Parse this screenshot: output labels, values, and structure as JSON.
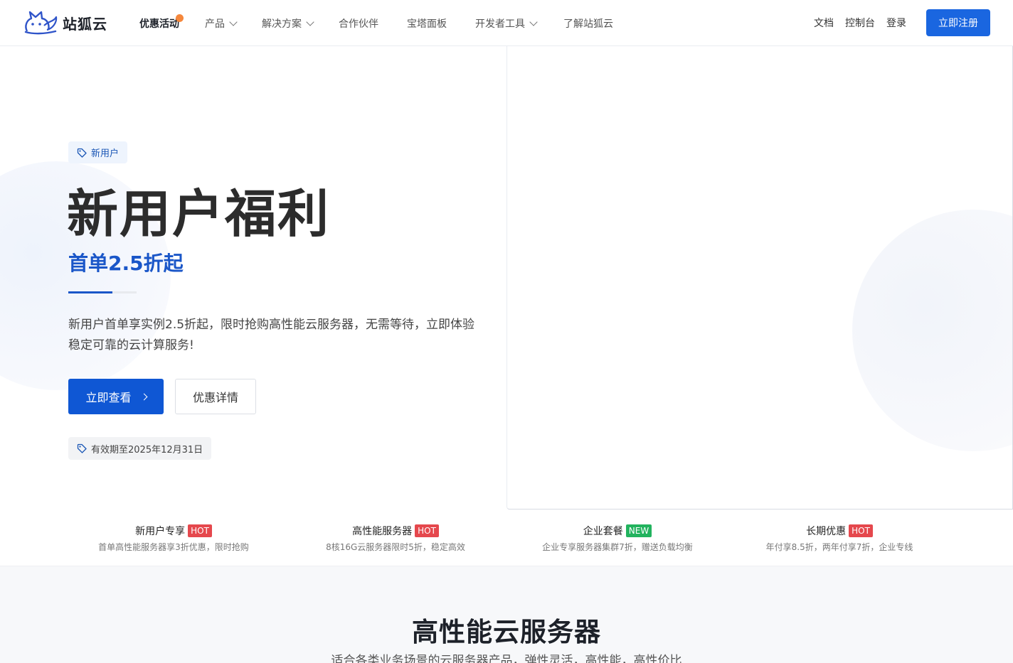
{
  "header": {
    "logo_text": "站狐云",
    "nav": [
      {
        "label": "优惠活动",
        "active": true,
        "dropdown": false
      },
      {
        "label": "产品",
        "active": false,
        "dropdown": true
      },
      {
        "label": "解决方案",
        "active": false,
        "dropdown": true
      },
      {
        "label": "合作伙伴",
        "active": false,
        "dropdown": false
      },
      {
        "label": "宝塔面板",
        "active": false,
        "dropdown": false
      },
      {
        "label": "开发者工具",
        "active": false,
        "dropdown": true
      },
      {
        "label": "了解站狐云",
        "active": false,
        "dropdown": false
      }
    ],
    "right_links": [
      "文档",
      "控制台",
      "登录"
    ],
    "register_label": "立即注册"
  },
  "hero": {
    "tag": "新用户",
    "title": "新用户福利",
    "subtitle": "首单2.5折起",
    "description": "新用户首单享实例2.5折起，限时抢购高性能云服务器，无需等待，立即体验稳定可靠的云计算服务!",
    "primary_button": "立即查看",
    "secondary_button": "优惠详情",
    "validity": "有效期至2025年12月31日"
  },
  "promos": [
    {
      "title": "新用户专享",
      "badge": "HOT",
      "badge_color": "#e5484d",
      "desc": "首单高性能服务器享3折优惠，限时抢购"
    },
    {
      "title": "高性能服务器",
      "badge": "HOT",
      "badge_color": "#e5484d",
      "desc": "8核16G云服务器限时5折，稳定高效"
    },
    {
      "title": "企业套餐",
      "badge": "NEW",
      "badge_color": "#22b35e",
      "desc": "企业专享服务器集群7折，赠送负载均衡"
    },
    {
      "title": "长期优惠",
      "badge": "HOT",
      "badge_color": "#e5484d",
      "desc": "年付享8.5折，两年付享7折，企业专线"
    }
  ],
  "section": {
    "title": "高性能云服务器",
    "subtitle": "适合各类业务场景的云服务器产品，弹性灵活，高性能，高性价比"
  },
  "colors": {
    "brand_blue": "#0f57d4",
    "accent_orange": "#f5873c",
    "hot_red": "#e5484d",
    "new_green": "#22b35e"
  }
}
